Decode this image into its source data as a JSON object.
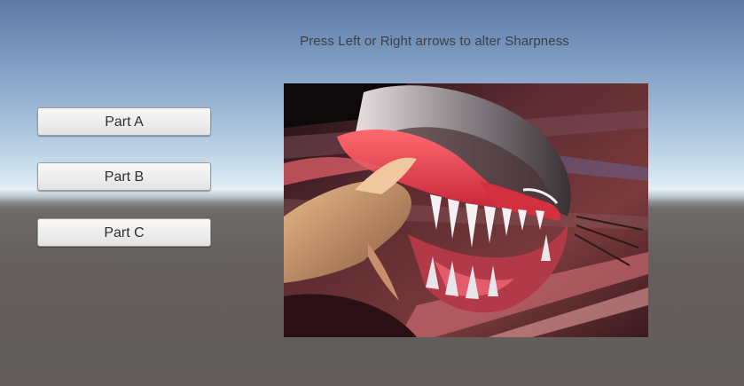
{
  "instruction": "Press Left or Right arrows to alter Sharpness",
  "buttons": [
    {
      "label": "Part A"
    },
    {
      "label": "Part B"
    },
    {
      "label": "Part C"
    }
  ],
  "image": {
    "subject": "sharpened monster artwork"
  },
  "colors": {
    "sky_top": "#5d7aa6",
    "horizon": "#e5eef3",
    "ground": "#625d5a",
    "button_bg": "#ececec",
    "text": "#3b3f46"
  }
}
